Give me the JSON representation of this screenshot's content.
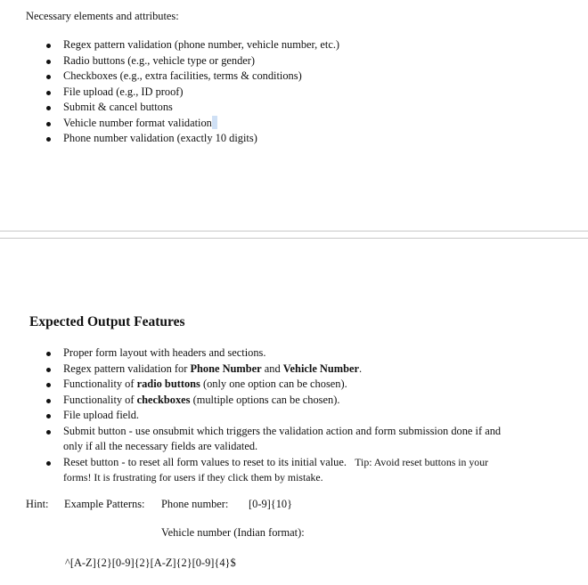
{
  "intro": {
    "text": "Necessary elements and attributes:"
  },
  "requirements": [
    "Regex pattern validation (phone number, vehicle number, etc.)",
    "Radio buttons (e.g., vehicle type or gender)",
    "Checkboxes (e.g., extra facilities, terms & conditions)",
    "File upload (e.g., ID proof)",
    "Submit & cancel buttons",
    "Vehicle number format validation",
    "Phone number validation (exactly 10 digits)"
  ],
  "features": {
    "heading": "Expected Output Features",
    "items": [
      {
        "text": "Proper form layout with headers and sections."
      },
      {
        "pre": "Regex pattern validation for ",
        "bold1": "Phone Number",
        "mid": " and ",
        "bold2": "Vehicle Number",
        "post": "."
      },
      {
        "pre": "Functionality of ",
        "bold": "radio buttons",
        "post": " (only one option can be chosen)."
      },
      {
        "pre": "Functionality of ",
        "bold": "checkboxes",
        "post": " (multiple options can be chosen)."
      },
      {
        "text": "File upload field."
      },
      {
        "text": "Submit button - use onsubmit which triggers the validation action and form submission done if and only if all the necessary fields are validated."
      },
      {
        "main": "Reset button - to reset all form values to reset to its initial value.",
        "tip": "Tip: Avoid reset buttons in your forms! It is frustrating for users if they click them by mistake."
      }
    ]
  },
  "hint": {
    "label": "Hint:",
    "patterns_label": "Example Patterns:",
    "phone_label": "Phone number:",
    "phone_pattern": "[0-9]{10}",
    "vehicle_label": "Vehicle number (Indian format):",
    "vehicle_pattern": "^[A-Z]{2}[0-9]{2}[A-Z]{2}[0-9]{4}$"
  },
  "colors": {
    "text": "#111111",
    "cursor_highlight": "#cfe0f5",
    "page_gap_border": "#c8c8c8"
  }
}
